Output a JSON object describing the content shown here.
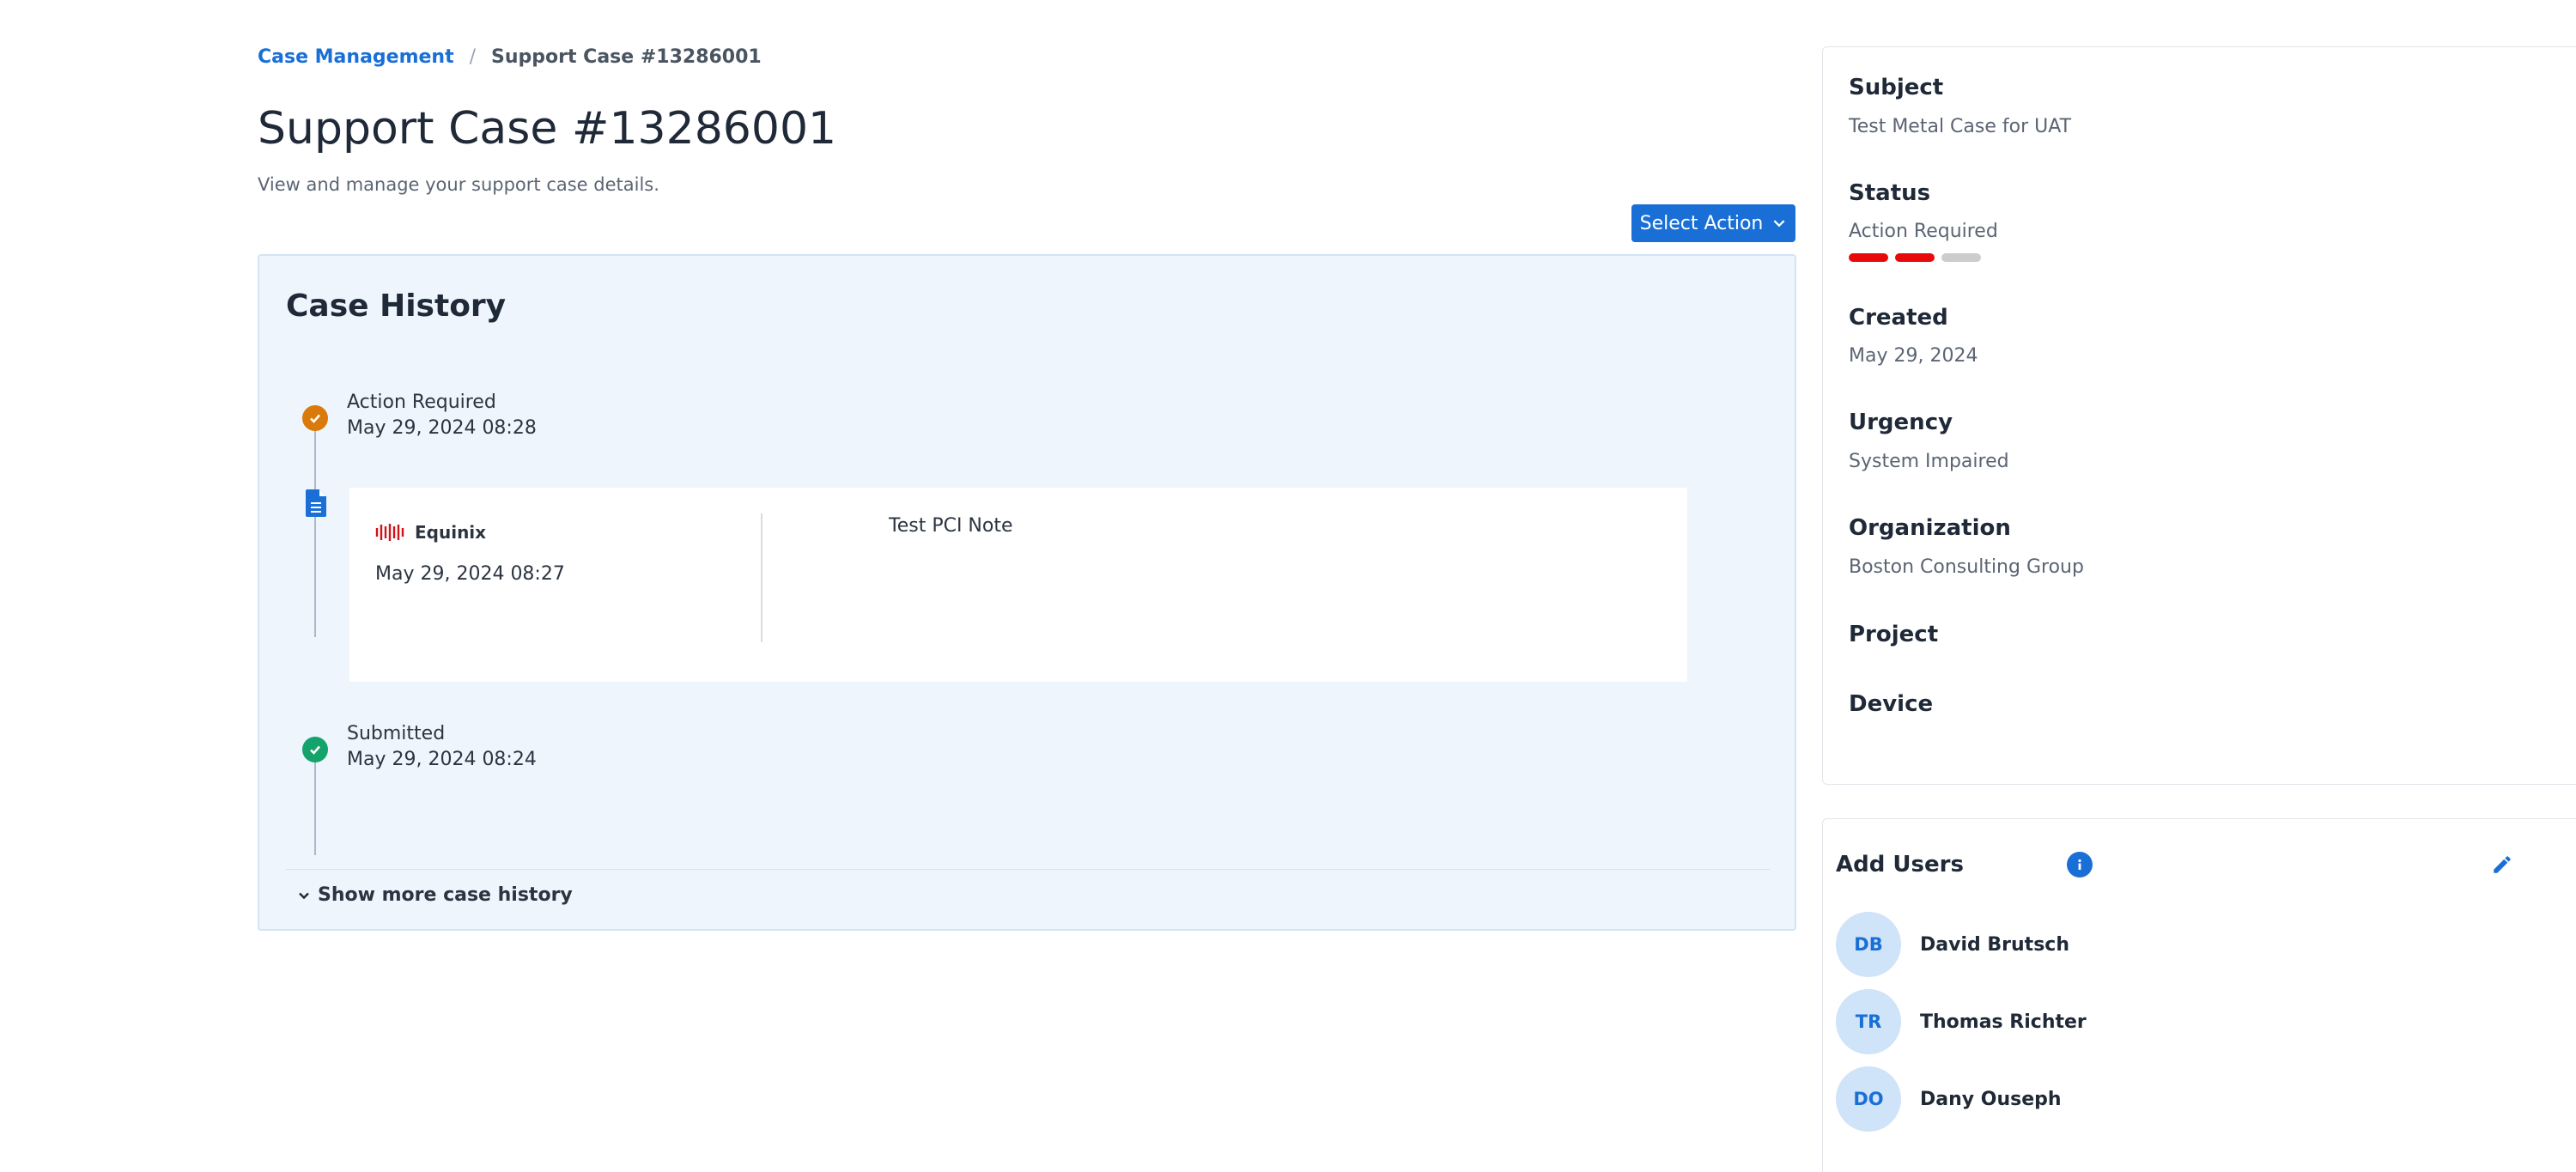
{
  "breadcrumb": {
    "root": "Case Management",
    "separator": "/",
    "current": "Support Case #13286001"
  },
  "page": {
    "title": "Support Case #13286001",
    "subtitle": "View and manage your support case details."
  },
  "actions": {
    "select_action_label": "Select Action"
  },
  "history": {
    "title": "Case History",
    "events": [
      {
        "label": "Action Required",
        "timestamp": "May 29, 2024 08:28",
        "icon": "check-circle-icon",
        "color": "#d97a0b"
      },
      {
        "label": "Submitted",
        "timestamp": "May 29, 2024 08:24",
        "icon": "check-circle-icon",
        "color": "#14a36a"
      }
    ],
    "note": {
      "brand": "Equinix",
      "timestamp": "May 29, 2024 08:27",
      "text": "Test PCI Note",
      "icon": "document-icon"
    },
    "show_more_label": "Show more case history"
  },
  "details": {
    "subject_label": "Subject",
    "subject_value": "Test Metal Case for UAT",
    "status_label": "Status",
    "status_value": "Action Required",
    "status_level": {
      "filled": 2,
      "total": 3,
      "fill_color": "#e8090b",
      "empty_color": "#cccccc"
    },
    "created_label": "Created",
    "created_value": "May 29, 2024",
    "urgency_label": "Urgency",
    "urgency_value": "System Impaired",
    "organization_label": "Organization",
    "organization_value": "Boston Consulting Group",
    "project_label": "Project",
    "device_label": "Device"
  },
  "users": {
    "title": "Add Users",
    "list": [
      {
        "initials": "DB",
        "name": "David Brutsch"
      },
      {
        "initials": "TR",
        "name": "Thomas Richter"
      },
      {
        "initials": "DO",
        "name": "Dany Ouseph"
      }
    ]
  },
  "colors": {
    "accent": "#1a6fd6",
    "panel_bg": "#eef5fd",
    "brand_red": "#d0121b"
  }
}
